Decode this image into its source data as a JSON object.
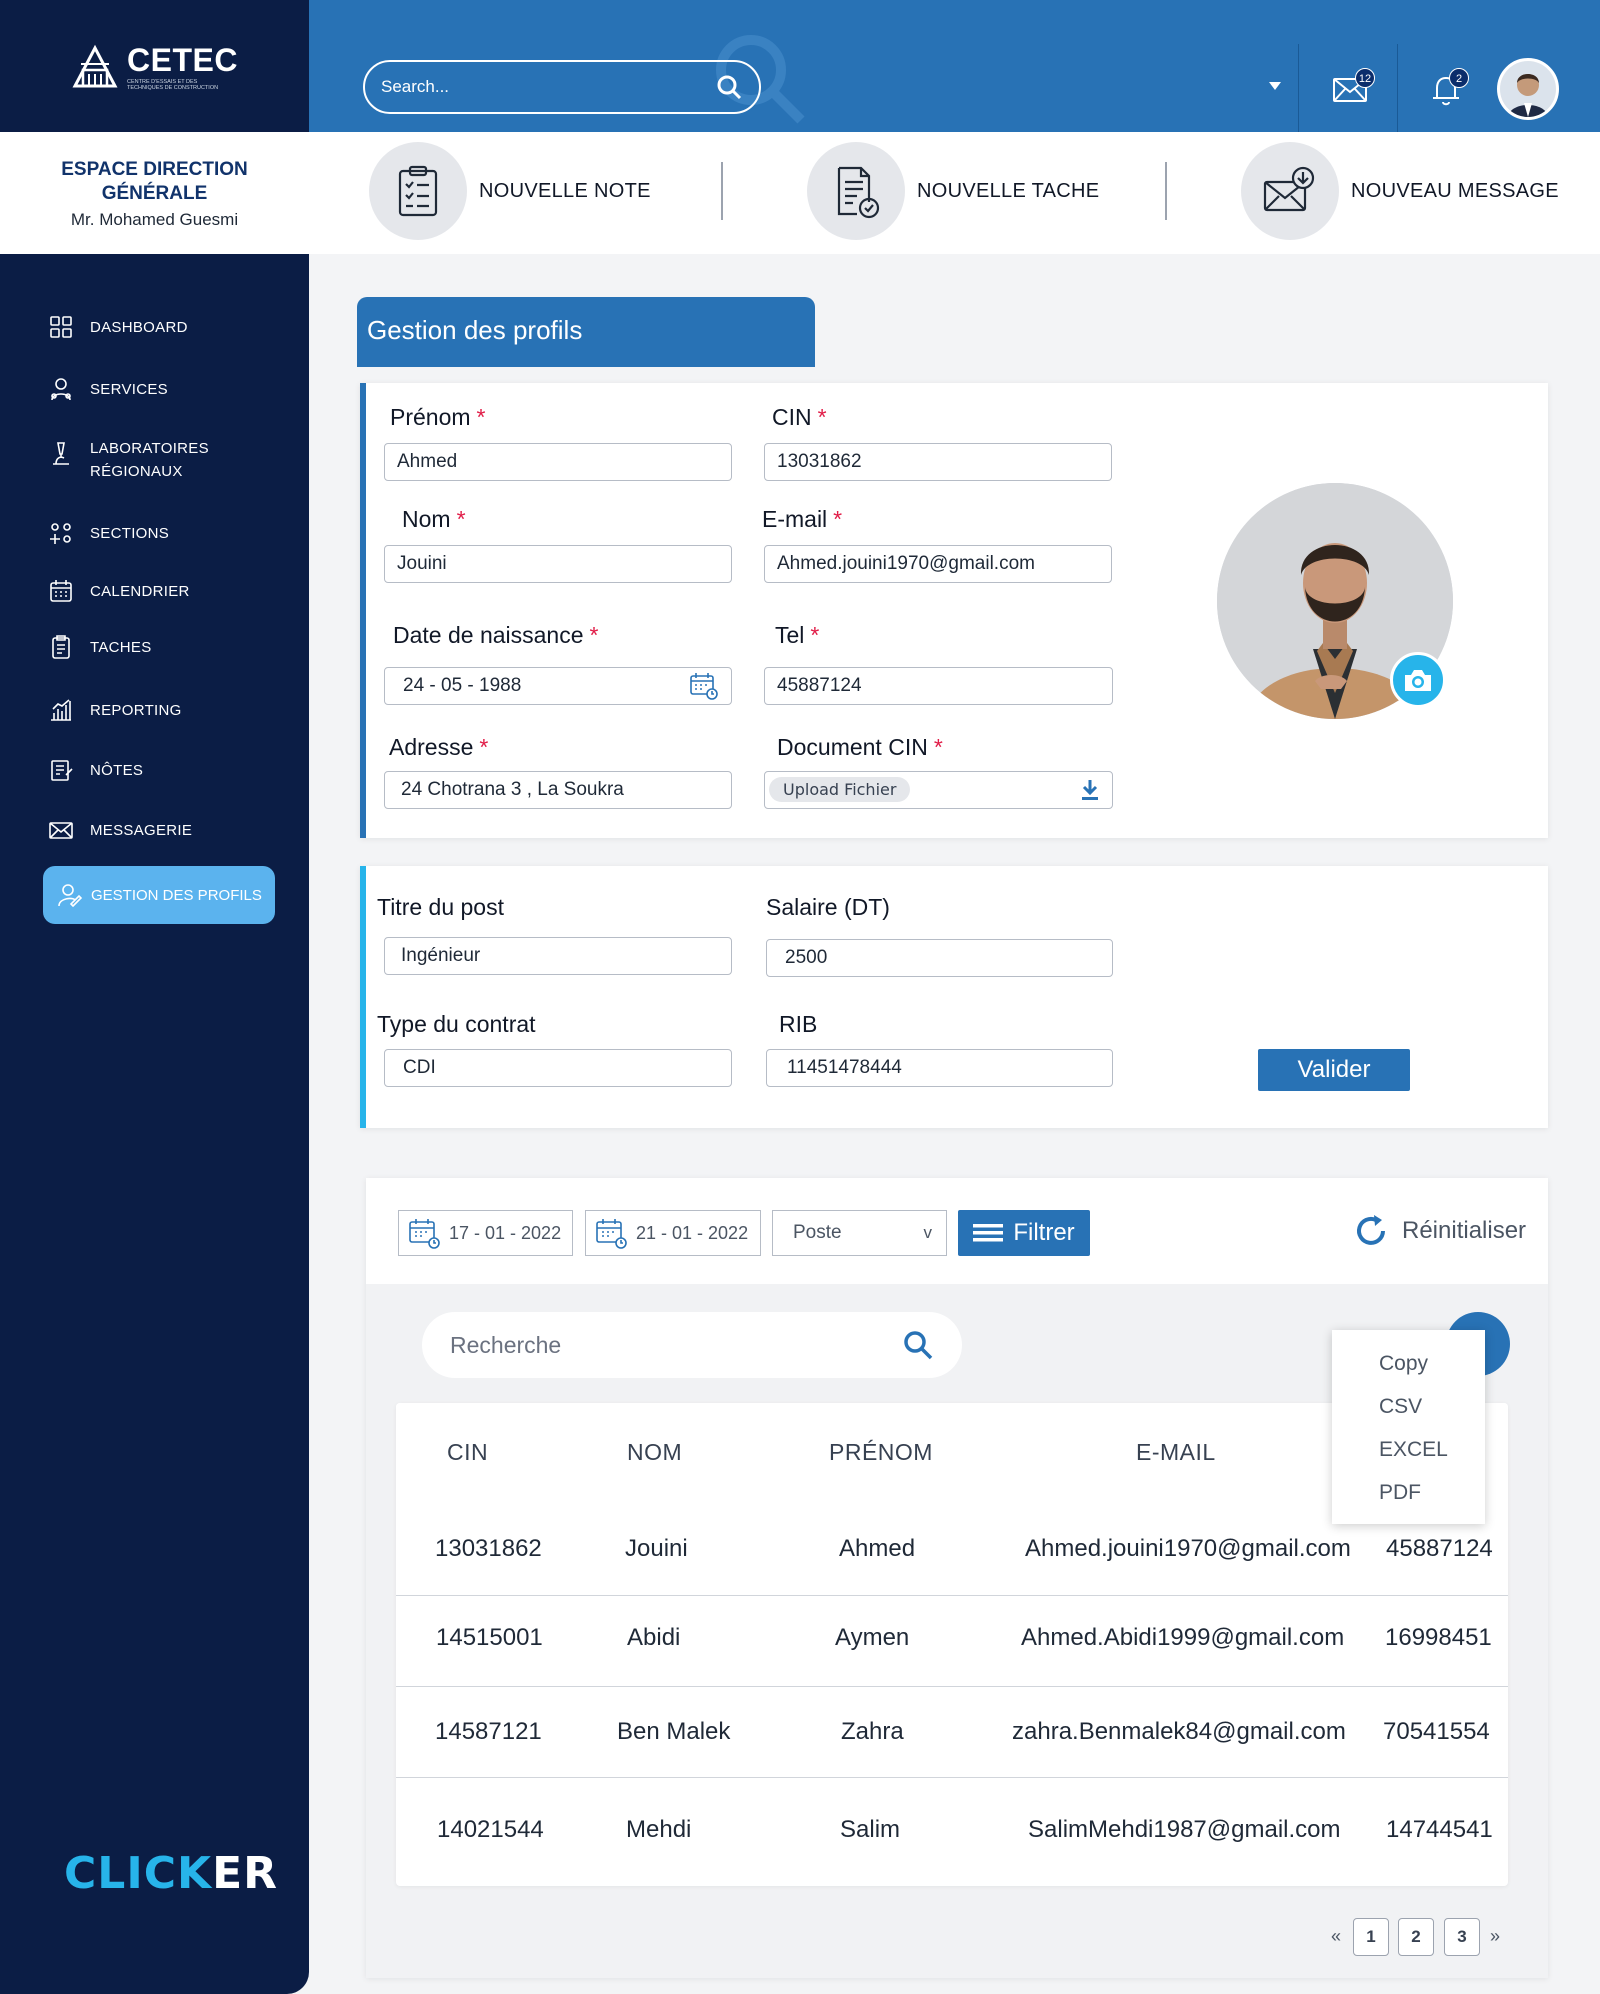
{
  "brand": {
    "logo_text": "CETEC",
    "logo_sub": "CENTRE D'ESSAIS ET DES TECHNIQUES DE CONSTRUCTION",
    "espace_line1": "ESPACE DIRECTION",
    "espace_line2": "GÉNÉRALE",
    "user_name": "Mr. Mohamed Guesmi",
    "footer_logo_a": "CLICK",
    "footer_logo_b": "ER"
  },
  "sidebar": {
    "items": [
      {
        "label": "DASHBOARD",
        "icon": "grid-icon"
      },
      {
        "label": "SERVICES",
        "icon": "services-icon"
      },
      {
        "label": "LABORATOIRES",
        "label2": "RÉGIONAUX",
        "icon": "microscope-icon"
      },
      {
        "label": "SECTIONS",
        "icon": "sections-icon"
      },
      {
        "label": "CALENDRIER",
        "icon": "calendar-icon"
      },
      {
        "label": "TACHES",
        "icon": "tasks-icon"
      },
      {
        "label": "REPORTING",
        "icon": "chart-icon"
      },
      {
        "label": "NÔTES",
        "icon": "notes-icon"
      },
      {
        "label": "MESSAGERIE",
        "icon": "mail-icon"
      }
    ],
    "active": {
      "label": "GESTION DES PROFILS",
      "icon": "user-edit-icon"
    }
  },
  "header": {
    "search_placeholder": "Search...",
    "mail_count": "12",
    "notif_count": "2"
  },
  "quick_actions": [
    {
      "label": "NOUVELLE NOTE"
    },
    {
      "label": "NOUVELLE TACHE"
    },
    {
      "label": "NOUVEAU MESSAGE"
    }
  ],
  "page": {
    "title": "Gestion des profils"
  },
  "form": {
    "prenom": {
      "label": "Prénom",
      "value": "Ahmed"
    },
    "cin": {
      "label": "CIN",
      "value": "13031862"
    },
    "nom": {
      "label": "Nom",
      "value": "Jouini"
    },
    "email": {
      "label": "E-mail",
      "value": "Ahmed.jouini1970@gmail.com"
    },
    "naissance": {
      "label": "Date de naissance",
      "value": "24 - 05 - 1988"
    },
    "tel": {
      "label": "Tel",
      "value": "45887124"
    },
    "adresse": {
      "label": "Adresse",
      "value": "24 Chotrana 3 , La Soukra"
    },
    "doc_cin": {
      "label": "Document CIN",
      "value": "Upload Fichier"
    },
    "required_mark": "*"
  },
  "job": {
    "titre": {
      "label": "Titre du post",
      "value": "Ingénieur"
    },
    "salaire": {
      "label": "Salaire (DT)",
      "value": "2500"
    },
    "contrat": {
      "label": "Type du contrat",
      "value": "CDI"
    },
    "rib": {
      "label": "RIB",
      "value": "11451478444"
    },
    "valider": "Valider"
  },
  "filters": {
    "date_from": "17 - 01 - 2022",
    "date_to": "21 - 01 - 2022",
    "poste": "Poste",
    "poste_caret": "v",
    "filtrer": "Filtrer",
    "reinit": "Réinitialiser",
    "recherche_placeholder": "Recherche"
  },
  "export_menu": [
    "Copy",
    "CSV",
    "EXCEL",
    "PDF"
  ],
  "table": {
    "headers": [
      "CIN",
      "NOM",
      "PRÉNOM",
      "E-MAIL"
    ],
    "rows": [
      [
        "13031862",
        "Jouini",
        "Ahmed",
        "Ahmed.jouini1970@gmail.com",
        "45887124"
      ],
      [
        "14515001",
        "Abidi",
        "Aymen",
        "Ahmed.Abidi1999@gmail.com",
        "16998451"
      ],
      [
        "14587121",
        "Ben Malek",
        "Zahra",
        "zahra.Benmalek84@gmail.com",
        "70541554"
      ],
      [
        "14021544",
        "Mehdi",
        "Salim",
        "SalimMehdi1987@gmail.com",
        "14744541"
      ]
    ]
  },
  "pagination": {
    "prev": "«",
    "pages": [
      "1",
      "2",
      "3"
    ],
    "next": "»"
  },
  "colors": {
    "primary": "#2872b5",
    "sidebar": "#0b1d45",
    "accent": "#27b4ea",
    "active": "#5bb3ee",
    "required": "#e11d48"
  }
}
